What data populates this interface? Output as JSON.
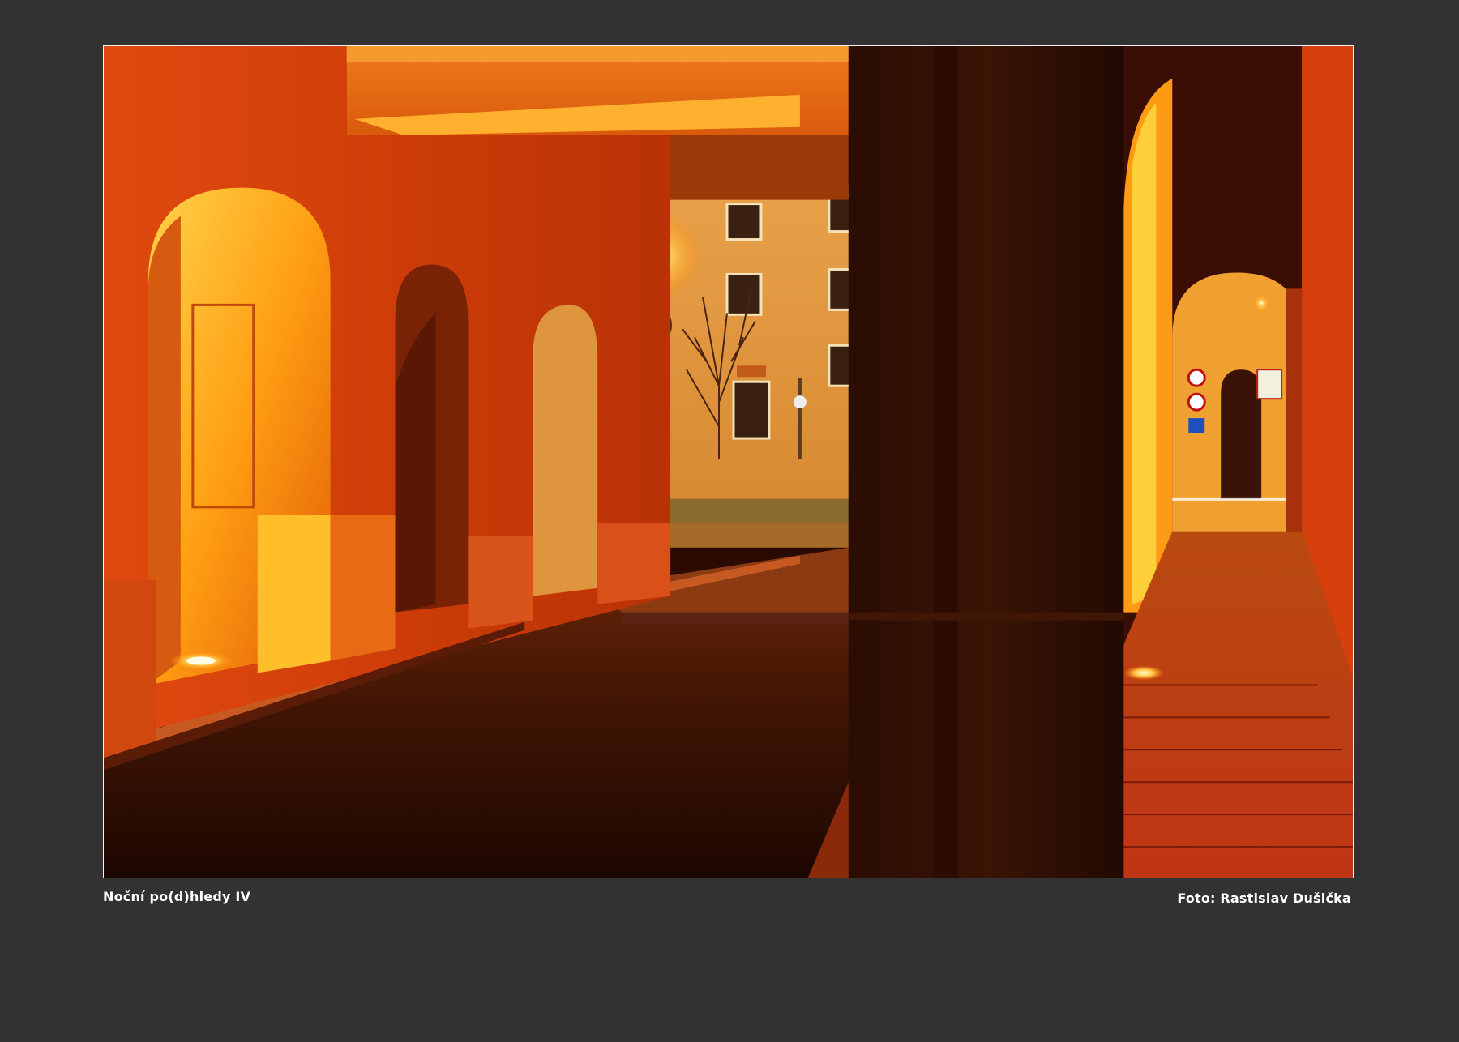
{
  "photo": {
    "subject": "night-arcade-street-scene"
  },
  "caption": {
    "title": "Noční po(d)hledy IV",
    "credit": "Foto: Rastislav Dušička"
  },
  "colors": {
    "background": "#323232",
    "frame_border": "#f2f2f2",
    "caption_text": "#ffffff",
    "warm_light": "#ffb300",
    "wall_orange": "#d64a0c",
    "shadow": "#2a0a00"
  }
}
